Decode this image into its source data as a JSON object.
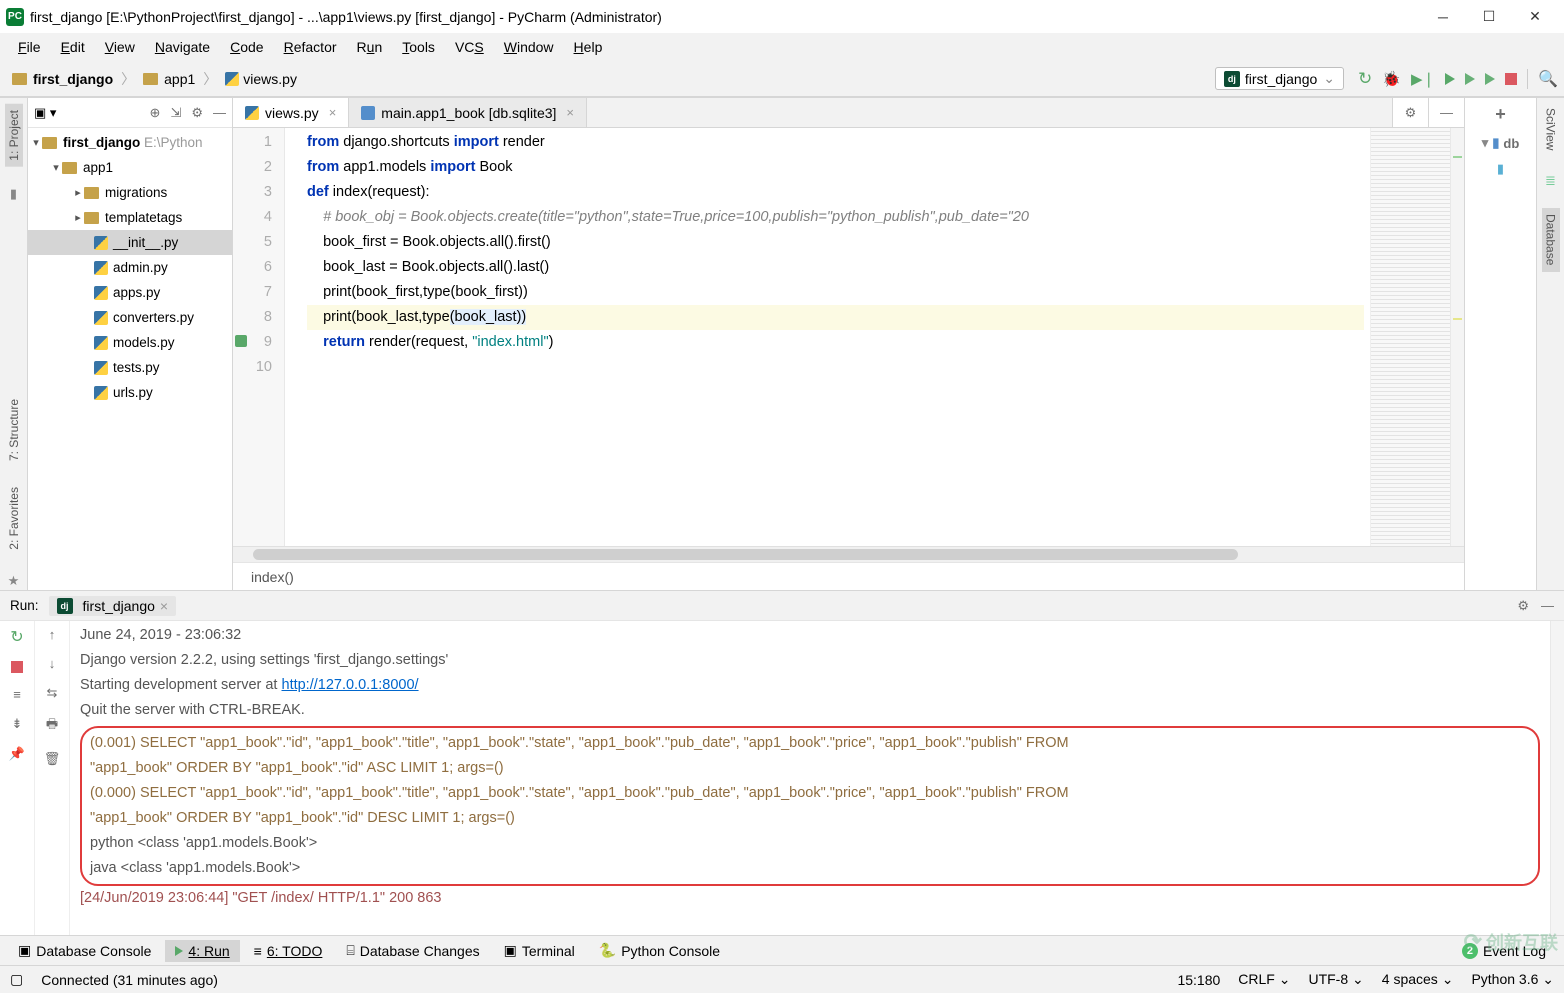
{
  "window": {
    "title": "first_django [E:\\PythonProject\\first_django] - ...\\app1\\views.py [first_django] - PyCharm (Administrator)"
  },
  "menu": {
    "items": [
      "File",
      "Edit",
      "View",
      "Navigate",
      "Code",
      "Refactor",
      "Run",
      "Tools",
      "VCS",
      "Window",
      "Help"
    ]
  },
  "breadcrumb": {
    "root": "first_django",
    "mid": "app1",
    "file": "views.py"
  },
  "runconfig": {
    "name": "first_django"
  },
  "project": {
    "root": "first_django",
    "rootPath": "E:\\Python",
    "app": "app1",
    "migrations": "migrations",
    "templatetags": "templatetags",
    "files": {
      "init": "__init__.py",
      "admin": "admin.py",
      "apps": "apps.py",
      "converters": "converters.py",
      "models": "models.py",
      "tests": "tests.py",
      "urls": "urls.py"
    }
  },
  "leftTools": {
    "project": "1: Project",
    "structure": "7: Structure",
    "favorites": "2: Favorites"
  },
  "rightTools": {
    "sciview": "SciView",
    "database": "Database",
    "dbLabel": "db"
  },
  "tabs": {
    "t1": "views.py",
    "t2": "main.app1_book [db.sqlite3]"
  },
  "code": {
    "l1a": "from",
    "l1b": " django.shortcuts ",
    "l1c": "import",
    "l1d": " render",
    "l2a": "from",
    "l2b": " app1.models ",
    "l2c": "import",
    "l2d": " Book",
    "l3a": "def ",
    "l3b": "index",
    "l3c": "(request):",
    "l4": "    # book_obj = Book.objects.create(title=\"python\",state=True,price=100,publish=\"python_publish\",pub_date=\"20",
    "l5": "    book_first = Book.objects.all().first()",
    "l6": "    book_last = Book.objects.all().last()",
    "l7a": "    print",
    "l7b": "(book_first,",
    "l7c": "type",
    "l7d": "(book_first))",
    "l8a": "    print",
    "l8b": "(book_last,",
    "l8c": "type",
    "l8d": "(book_last))",
    "l9a": "    return ",
    "l9b": "render(request, ",
    "l9c": "\"index.html\"",
    "l9d": ")"
  },
  "gutter": [
    "1",
    "2",
    "3",
    "4",
    "5",
    "6",
    "7",
    "8",
    "9",
    "10"
  ],
  "editorBreadcrumb": "index()",
  "run": {
    "label": "Run:",
    "tab": "first_django",
    "lines": {
      "date": "June 24, 2019 - 23:06:32",
      "ver": "Django version 2.2.2, using settings 'first_django.settings'",
      "startA": "Starting development server at ",
      "startUrl": "http://127.0.0.1:8000/",
      "quit": "Quit the server with CTRL-BREAK.",
      "sql1a": "(0.001) SELECT \"app1_book\".\"id\", \"app1_book\".\"title\", \"app1_book\".\"state\", \"app1_book\".\"pub_date\", \"app1_book\".\"price\", \"app1_book\".\"publish\" FROM ",
      "sql1b": "\"app1_book\" ORDER BY \"app1_book\".\"id\" ASC  LIMIT 1; args=()",
      "sql2a": "(0.000) SELECT \"app1_book\".\"id\", \"app1_book\".\"title\", \"app1_book\".\"state\", \"app1_book\".\"pub_date\", \"app1_book\".\"price\", \"app1_book\".\"publish\" FROM",
      "sql2b": " \"app1_book\" ORDER BY \"app1_book\".\"id\" DESC  LIMIT 1; args=()",
      "py": "python <class 'app1.models.Book'>",
      "jv": "java <class 'app1.models.Book'>",
      "http": "[24/Jun/2019 23:06:44] \"GET /index/ HTTP/1.1\" 200 863"
    }
  },
  "bottom": {
    "dbconsole": "Database Console",
    "run": "4: Run",
    "todo": "6: TODO",
    "dbchanges": "Database Changes",
    "terminal": "Terminal",
    "pyconsole": "Python Console",
    "eventlog": "Event Log",
    "badge": "2"
  },
  "status": {
    "connected": "Connected (31 minutes ago)",
    "pos": "15:180",
    "eol": "CRLF",
    "enc": "UTF-8",
    "indent": "4 spaces",
    "py": "Python 3.6"
  },
  "watermark": "创新互联"
}
